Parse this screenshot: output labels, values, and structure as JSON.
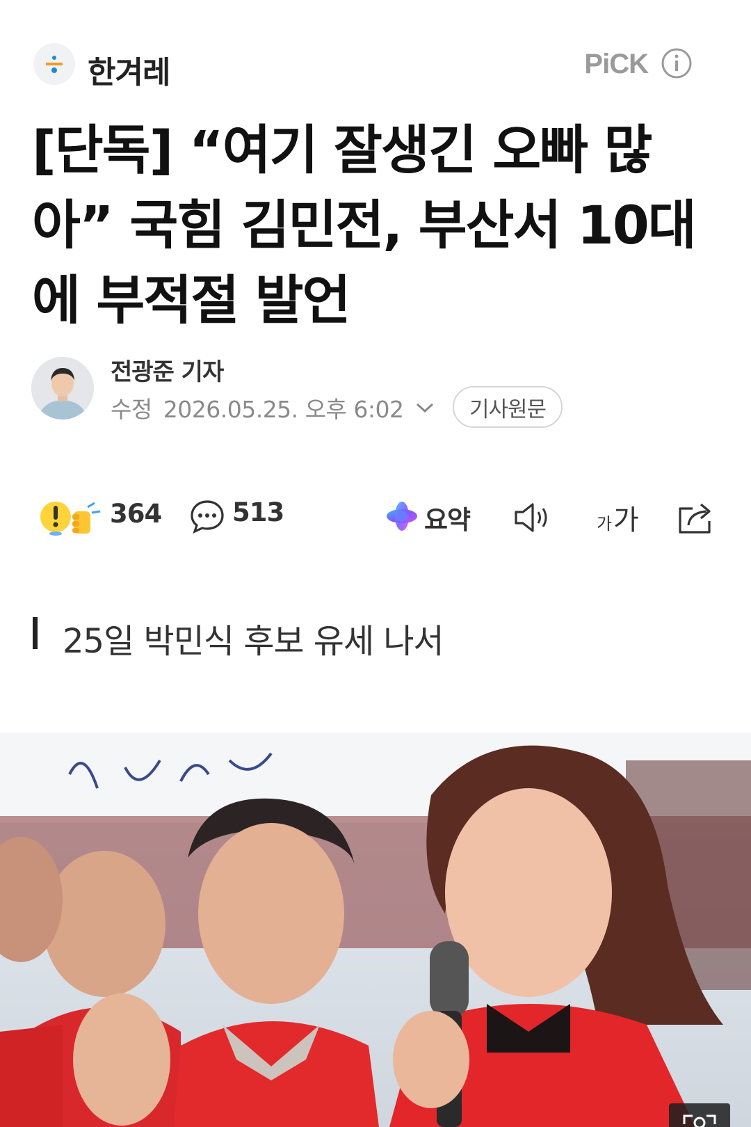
{
  "header": {
    "press_name": "한겨레",
    "pick_label": "PiCK"
  },
  "article": {
    "title": "[단독] “여기 잘생긴 오빠 많아” 국힘 김민전, 부산서 10대에 부적절 발언",
    "reporter": "전광준 기자",
    "date_label": "수정",
    "date_value": "2026.05.25. 오후 6:02",
    "original_button": "기사원문",
    "subtitle": "25일 박민식 후보 유세 나서"
  },
  "actions": {
    "reaction_count": "364",
    "comment_count": "513",
    "summary_label": "요약"
  },
  "colors": {
    "title": "#111111",
    "muted": "#8a8a8a",
    "logo_orange": "#f39a1e",
    "logo_blue": "#1d8bd6"
  },
  "icons": [
    "hankyoreh-logo-icon",
    "info-icon",
    "chevron-down-icon",
    "reaction-icons",
    "comment-icon",
    "ai-summary-icon",
    "speaker-icon",
    "font-size-icon",
    "share-icon",
    "expand-photo-icon"
  ]
}
